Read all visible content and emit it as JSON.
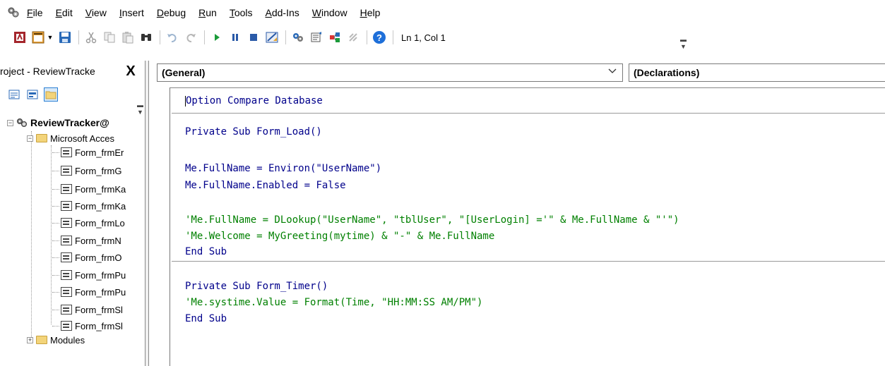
{
  "menubar": {
    "items": [
      {
        "label": "File",
        "mnemonic": "F"
      },
      {
        "label": "Edit",
        "mnemonic": "E"
      },
      {
        "label": "View",
        "mnemonic": "V"
      },
      {
        "label": "Insert",
        "mnemonic": "I"
      },
      {
        "label": "Debug",
        "mnemonic": "D"
      },
      {
        "label": "Run",
        "mnemonic": "R"
      },
      {
        "label": "Tools",
        "mnemonic": "T"
      },
      {
        "label": "Add-Ins",
        "mnemonic": "A"
      },
      {
        "label": "Window",
        "mnemonic": "W"
      },
      {
        "label": "Help",
        "mnemonic": "H"
      }
    ]
  },
  "toolbar": {
    "position": "Ln 1, Col 1"
  },
  "project": {
    "title": "roject - ReviewTracke",
    "close": "X",
    "root": "ReviewTracker@",
    "folder_objects": "Microsoft Acces",
    "forms": [
      "Form_frmEr",
      "Form_frmG",
      "Form_frmKa",
      "Form_frmKa",
      "Form_frmLo",
      "Form_frmN",
      "Form_frmO",
      "Form_frmPu",
      "Form_frmPu",
      "Form_frmSl",
      "Form_frmSl"
    ],
    "folder_modules": "Modules"
  },
  "code": {
    "object_combo": "(General)",
    "proc_combo": "(Declarations)",
    "line_option": "Option Compare Database",
    "load_sub_kw": "Private Sub",
    "load_sub_name": " Form_Load()",
    "load_line1": "Me.FullName = Environ(\"UserName\")",
    "load_line2_a": "Me.FullName.Enabled = ",
    "load_line2_b": "False",
    "load_comment1": "'Me.FullName = DLookup(\"UserName\", \"tblUser\", \"[UserLogin] ='\" & Me.FullName & \"'\")",
    "load_comment2": "'Me.Welcome = MyGreeting(mytime) & \"-\" & Me.FullName",
    "end_sub_1": "End Sub",
    "timer_sub_kw": "Private Sub",
    "timer_sub_name": " Form_Timer()",
    "timer_comment": "'Me.systime.Value = Format(Time, \"HH:MM:SS AM/PM\")",
    "end_sub_2": "End Sub"
  }
}
